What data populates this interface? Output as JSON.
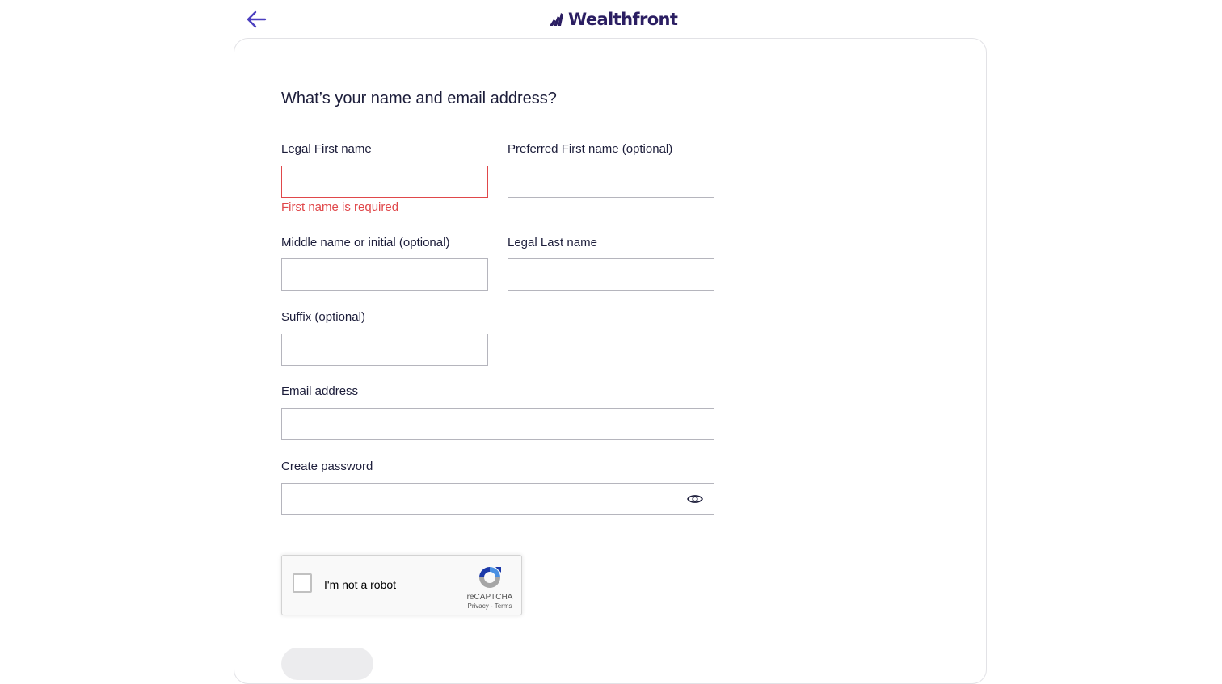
{
  "header": {
    "logo_text": "Wealthfront",
    "back_icon": "arrow-left-icon",
    "logo_icon": "wealthfront-mark-icon",
    "brand_color": "#2b1e62",
    "accent_color": "#4b3fbf"
  },
  "form": {
    "heading": "What’s your name and email address?",
    "first_name": {
      "label": "Legal First name",
      "value": "",
      "error": "First name is required"
    },
    "preferred_first_name": {
      "label": "Preferred First name (optional)",
      "value": ""
    },
    "middle_name": {
      "label": "Middle name or initial (optional)",
      "value": ""
    },
    "last_name": {
      "label": "Legal Last name",
      "value": ""
    },
    "suffix": {
      "label": "Suffix (optional)",
      "value": ""
    },
    "email": {
      "label": "Email address",
      "value": ""
    },
    "password": {
      "label": "Create password",
      "value": "",
      "toggle_icon": "eye-icon"
    },
    "error_color": "#e0474a"
  },
  "captcha": {
    "label": "I'm not a robot",
    "brand": "reCAPTCHA",
    "privacy": "Privacy",
    "separator": " - ",
    "terms": "Terms",
    "icon": "recaptcha-icon"
  }
}
